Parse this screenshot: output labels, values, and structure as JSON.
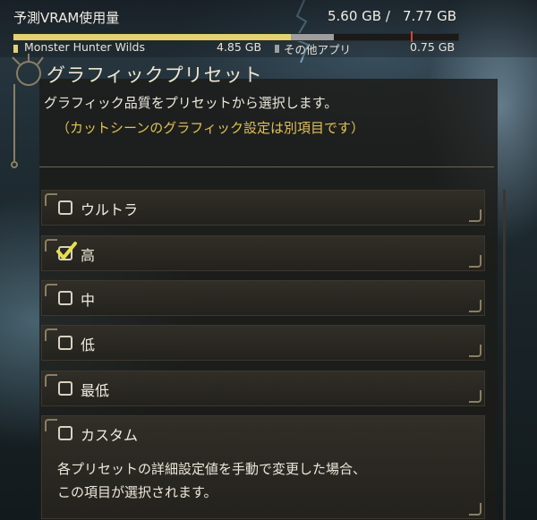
{
  "vram": {
    "title": "予測VRAM使用量",
    "used": "5.60 GB /",
    "total": "7.77 GB",
    "app_name": "Monster Hunter Wilds",
    "app_usage": "4.85 GB",
    "other_name": "その他アプリ",
    "other_usage": "0.75 GB",
    "app_fraction": 0.624,
    "other_fraction": 0.097,
    "colors": {
      "app": "#e3d36f",
      "other": "#9e9e9e",
      "limit_marker": "#cc4a3a"
    }
  },
  "panel": {
    "title": "グラフィックプリセット",
    "description": "グラフィック品質をプリセットから選択します。",
    "note": "（カットシーンのグラフィック設定は別項目です）",
    "note_color": "#e1c14e"
  },
  "options": [
    {
      "label": "ウルトラ",
      "checked": false
    },
    {
      "label": "高",
      "checked": true
    },
    {
      "label": "中",
      "checked": false
    },
    {
      "label": "低",
      "checked": false
    },
    {
      "label": "最低",
      "checked": false
    },
    {
      "label": "カスタム",
      "checked": false
    }
  ],
  "custom_description": [
    "各プリセットの詳細設定値を手動で変更した場合、",
    "この項目が選択されます。"
  ],
  "icons": {
    "check": "check-icon",
    "checkbox": "checkbox-icon"
  }
}
